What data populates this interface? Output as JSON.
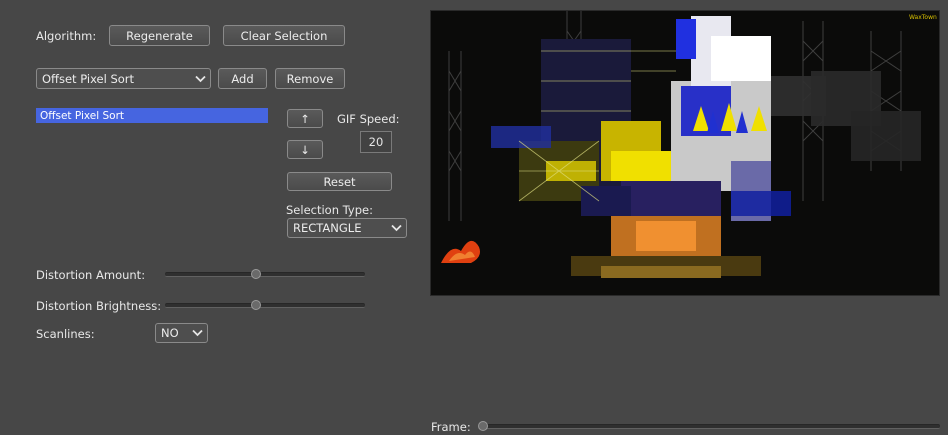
{
  "top": {
    "algorithm_label": "Algorithm:",
    "regenerate_label": "Regenerate",
    "clear_selection_label": "Clear Selection"
  },
  "effects": {
    "selected_effect": "Offset Pixel Sort",
    "add_label": "Add",
    "remove_label": "Remove",
    "list_items": [
      "Offset Pixel Sort"
    ]
  },
  "controls": {
    "move_up_label": "↑",
    "move_down_label": "↓",
    "gif_speed_label": "GIF Speed:",
    "gif_speed_value": "20",
    "reset_label": "Reset",
    "selection_type_label": "Selection Type:",
    "selection_type_value": "RECTANGLE"
  },
  "sliders": {
    "distortion_amount_label": "Distortion Amount:",
    "distortion_amount_value": 0.43,
    "distortion_brightness_label": "Distortion Brightness:",
    "distortion_brightness_value": 0.43
  },
  "scanlines": {
    "label": "Scanlines:",
    "value": "NO"
  },
  "preview": {
    "watermark": "WaxTown"
  },
  "frame": {
    "label": "Frame:",
    "value": 0
  },
  "colors": {
    "background": "#474747",
    "selection": "#4665e0",
    "watermark": "#d8c000"
  },
  "icons": {
    "dropdown": "chevron-down-icon",
    "up": "arrow-up-icon",
    "down": "arrow-down-icon"
  }
}
